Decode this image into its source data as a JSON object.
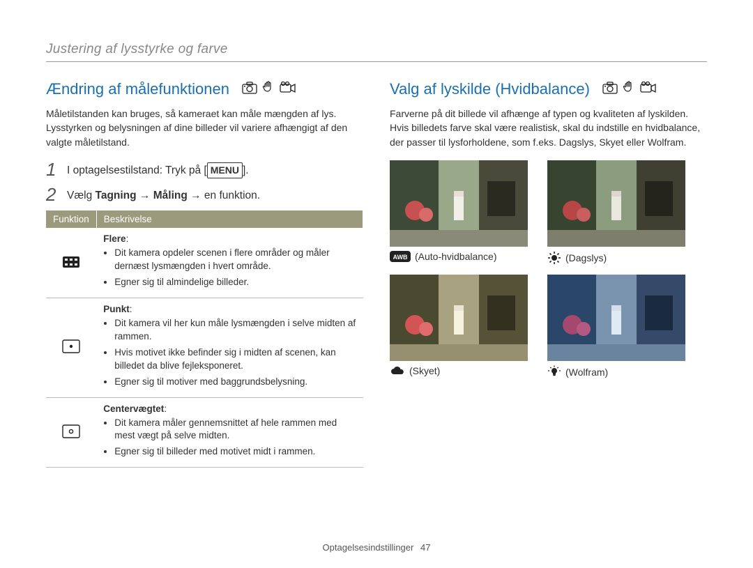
{
  "header": "Justering af lysstyrke og farve",
  "left": {
    "title": "Ændring af målefunktionen",
    "intro": "Måletilstanden kan bruges, så kameraet kan måle mængden af lys. Lysstyrken og belysningen af dine billeder vil variere afhængigt af den valgte måletilstand.",
    "step1_prefix": "I optagelsestilstand: Tryk på [",
    "step1_menu": "MENU",
    "step1_suffix": "].",
    "step2_prefix": "Vælg ",
    "step2_bold": "Tagning → Måling",
    "step2_suffix": " → en funktion.",
    "th_func": "Funktion",
    "th_desc": "Beskrivelse",
    "rows": [
      {
        "name": "Flere",
        "bullets": [
          "Dit kamera opdeler scenen i flere områder og måler dernæst lysmængden i hvert område.",
          "Egner sig til almindelige billeder."
        ]
      },
      {
        "name": "Punkt",
        "bullets": [
          "Dit kamera vil her kun måle lysmængden i selve midten af rammen.",
          "Hvis motivet ikke befinder sig i midten af scenen, kan billedet da blive fejleksponeret.",
          "Egner sig til motiver med baggrundsbelysning."
        ]
      },
      {
        "name": "Centervægtet",
        "bullets": [
          "Dit kamera måler gennemsnittet af hele rammen med mest vægt på selve midten.",
          "Egner sig til billeder med motivet midt i rammen."
        ]
      }
    ]
  },
  "right": {
    "title": "Valg af lyskilde (Hvidbalance)",
    "intro": "Farverne på dit billede vil afhænge af typen og kvaliteten af lyskilden. Hvis billedets farve skal være realistisk, skal du indstille en hvidbalance, der passer til lysforholdene, som f.eks. Dagslys, Skyet eller Wolfram.",
    "items": [
      {
        "label": "(Auto-hvidbalance)"
      },
      {
        "label": "(Dagslys)"
      },
      {
        "label": "(Skyet)"
      },
      {
        "label": "(Wolfram)"
      }
    ]
  },
  "footer": {
    "text": "Optagelsesindstillinger",
    "page": "47"
  }
}
